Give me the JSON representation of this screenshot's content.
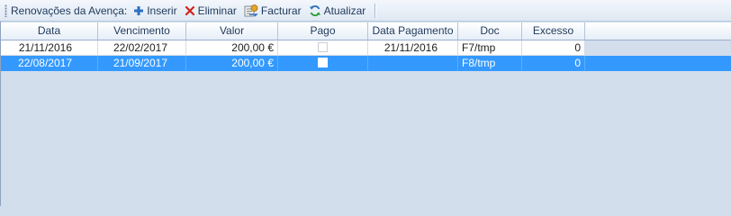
{
  "toolbar": {
    "title": "Renovações da Avença:",
    "buttons": [
      {
        "label": "Inserir",
        "icon": "plus-icon"
      },
      {
        "label": "Eliminar",
        "icon": "close-icon"
      },
      {
        "label": "Facturar",
        "icon": "invoice-icon"
      },
      {
        "label": "Atualizar",
        "icon": "refresh-icon"
      }
    ]
  },
  "grid": {
    "columns": [
      "Data",
      "Vencimento",
      "Valor",
      "Pago",
      "Data Pagamento",
      "Doc",
      "Excesso"
    ],
    "rows": [
      {
        "data": "21/11/2016",
        "vencimento": "22/02/2017",
        "valor": "200,00 €",
        "pago": false,
        "data_pagamento": "21/11/2016",
        "doc": "F7/tmp",
        "excesso": "0"
      },
      {
        "data": "22/08/2017",
        "vencimento": "21/09/2017",
        "valor": "200,00 €",
        "pago": false,
        "data_pagamento": "",
        "doc": "F8/tmp",
        "excesso": "0"
      }
    ]
  },
  "colors": {
    "selection": "#3399ff",
    "background": "#d2deec",
    "accent_red": "#d0241c",
    "accent_blue": "#2f6fc0"
  }
}
